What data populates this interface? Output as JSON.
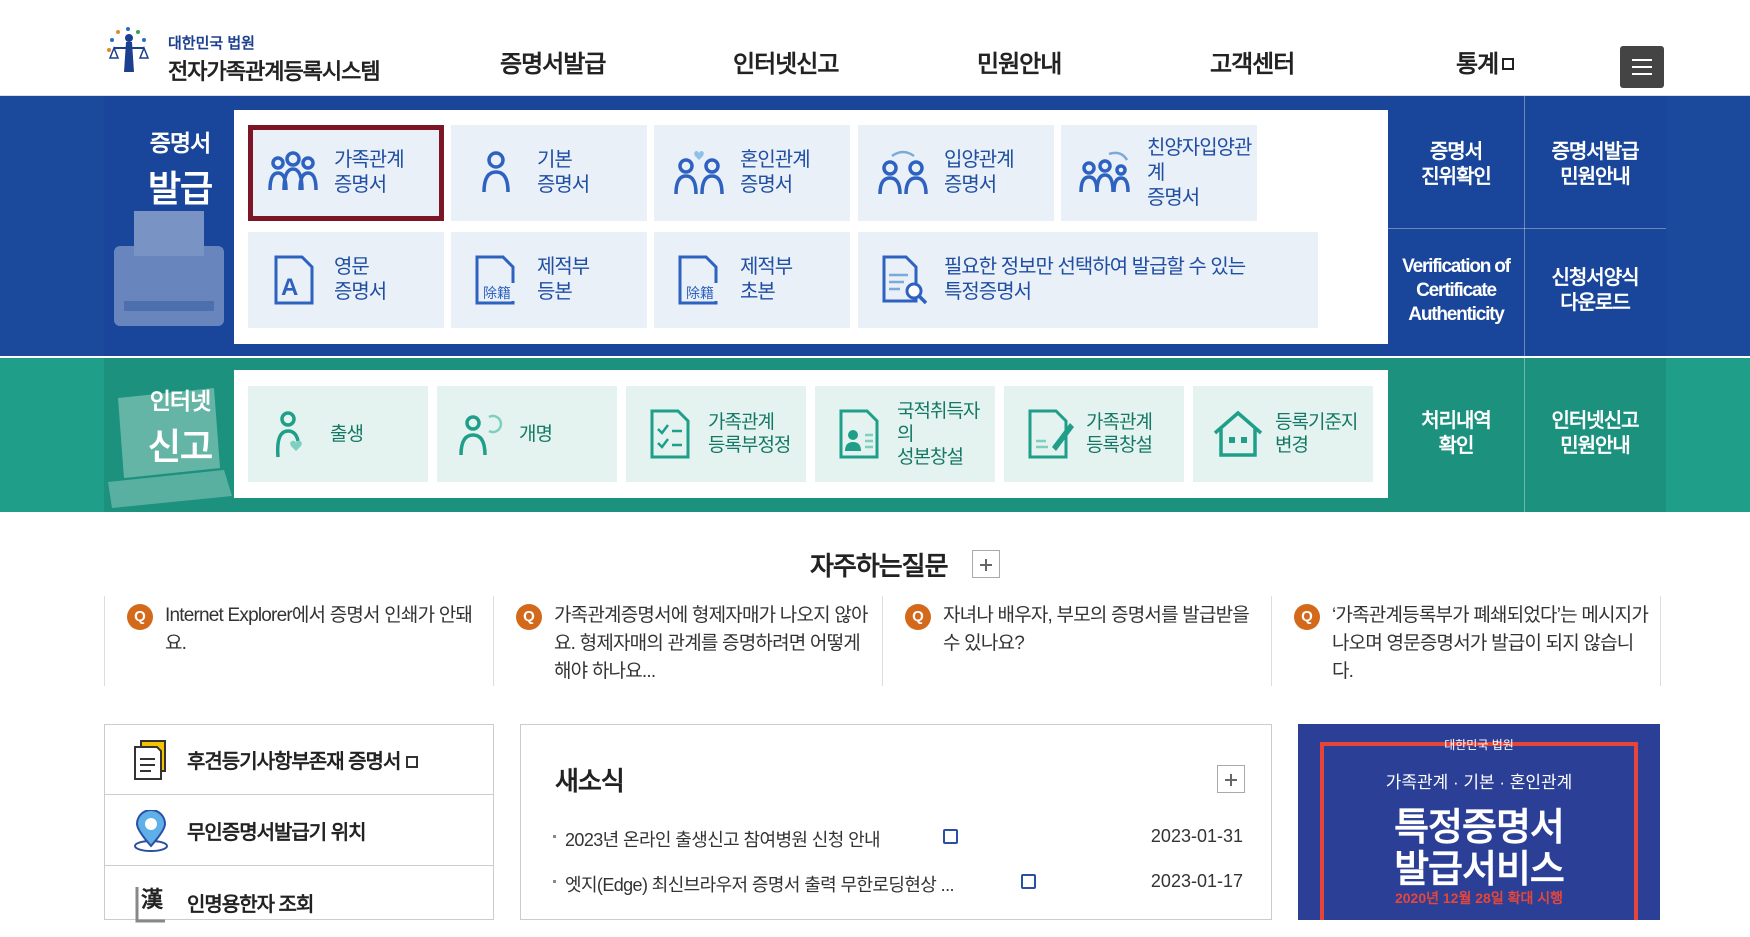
{
  "header": {
    "logo_sub": "대한민국 법원",
    "logo_main": "전자가족관계등록시스템",
    "nav": [
      "증명서발급",
      "인터넷신고",
      "민원안내",
      "고객센터",
      "통계"
    ]
  },
  "issue": {
    "title_small": "증명서",
    "title_big": "발급",
    "cards": [
      {
        "label": "가족관계\n증명서",
        "icon": "family-icon"
      },
      {
        "label": "기본\n증명서",
        "icon": "person-icon"
      },
      {
        "label": "혼인관계\n증명서",
        "icon": "couple-heart-icon"
      },
      {
        "label": "입양관계\n증명서",
        "icon": "adoption-icon"
      },
      {
        "label": "친양자입양관계\n증명서",
        "icon": "full-adoption-icon"
      },
      {
        "label": "영문\n증명서",
        "icon": "english-doc-icon"
      },
      {
        "label": "제적부\n등본",
        "icon": "removed-register-doc-icon"
      },
      {
        "label": "제적부\n초본",
        "icon": "removed-register-doc-icon"
      },
      {
        "label": "필요한 정보만 선택하여 발급할 수 있는\n특정증명서",
        "icon": "search-doc-icon"
      }
    ],
    "doc_badge": "除籍",
    "quick": [
      "증명서\n진위확인",
      "증명서발급\n민원안내",
      "Verification of\nCertificate\nAuthenticity",
      "신청서양식\n다운로드"
    ]
  },
  "report": {
    "title_small": "인터넷",
    "title_big": "신고",
    "cards": [
      {
        "label": "출생",
        "icon": "birth-icon"
      },
      {
        "label": "개명",
        "icon": "rename-icon"
      },
      {
        "label": "가족관계\n등록부정정",
        "icon": "register-correct-icon"
      },
      {
        "label": "국적취득자의\n성본창설",
        "icon": "naturalization-icon"
      },
      {
        "label": "가족관계\n등록창설",
        "icon": "register-create-icon"
      },
      {
        "label": "등록기준지\n변경",
        "icon": "house-icon"
      }
    ],
    "quick": [
      "처리내역\n확인",
      "인터넷신고\n민원안내"
    ]
  },
  "faq": {
    "title": "자주하는질문",
    "badge": "Q",
    "items": [
      "Internet Explorer에서 증명서 인쇄가 안돼요.",
      "가족관계증명서에 형제자매가 나오지 않아요. 형제자매의 관계를 증명하려면 어떻게 해야 하나요...",
      "자녀나 배우자, 부모의 증명서를 발급받을 수 있나요?",
      "‘가족관계등록부가 폐쇄되었다’는 메시지가 나오며 영문증명서가 발급이 되지 않습니다."
    ]
  },
  "links": [
    {
      "label": "후견등기사항부존재 증명서",
      "icon": "document-icon",
      "external": true
    },
    {
      "label": "무인증명서발급기 위치",
      "icon": "location-pin-icon",
      "external": false
    },
    {
      "label": "인명용한자 조회",
      "icon": "hanja-book-icon",
      "external": false
    }
  ],
  "hanja_glyph": "漢",
  "news": {
    "title": "새소식",
    "items": [
      {
        "title": "2023년 온라인 출생신고 참여병원 신청 안내",
        "date": "2023-01-31"
      },
      {
        "title": "엣지(Edge) 최신브라우저 증명서 출력 무한로딩현상 ...",
        "date": "2023-01-17"
      }
    ]
  },
  "banner": {
    "org": "대한민국 법원",
    "sub": "가족관계 · 기본 · 혼인관계",
    "main1": "특정증명서",
    "main2": "발급서비스",
    "note": "2020년 12월 28일 확대 시행"
  },
  "colors": {
    "issue_blue": "#1b4a9c",
    "report_teal": "#1f9f8a",
    "selected_outline": "#7c1626",
    "faq_orange": "#d3691b"
  }
}
